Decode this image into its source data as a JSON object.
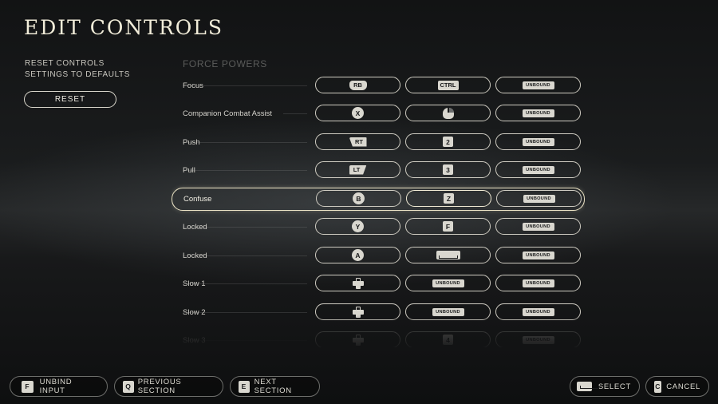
{
  "page": {
    "title": "EDIT CONTROLS"
  },
  "reset": {
    "description_line1": "RESET CONTROLS",
    "description_line2": "SETTINGS TO DEFAULTS",
    "button_label": "RESET"
  },
  "section": {
    "title": "FORCE POWERS"
  },
  "rows": [
    {
      "label": "Focus",
      "gamepad": "RB",
      "gamepad_icon": "rb-bumper-icon",
      "keyboard": "CTRL",
      "keyboard_icon": "ctrl-key-icon",
      "alt": "UNBOUND"
    },
    {
      "label": "Companion Combat Assist",
      "gamepad": "X",
      "gamepad_icon": "x-button-icon",
      "keyboard": "",
      "keyboard_icon": "mouse-right-click-icon",
      "alt": "UNBOUND"
    },
    {
      "label": "Push",
      "gamepad": "RT",
      "gamepad_icon": "rt-trigger-icon",
      "keyboard": "2",
      "keyboard_icon": "key-2-icon",
      "alt": "UNBOUND"
    },
    {
      "label": "Pull",
      "gamepad": "LT",
      "gamepad_icon": "lt-trigger-icon",
      "keyboard": "3",
      "keyboard_icon": "key-3-icon",
      "alt": "UNBOUND"
    },
    {
      "label": "Confuse",
      "gamepad": "B",
      "gamepad_icon": "b-button-icon",
      "keyboard": "Z",
      "keyboard_icon": "key-z-icon",
      "alt": "UNBOUND",
      "selected": true
    },
    {
      "label": "Locked",
      "gamepad": "Y",
      "gamepad_icon": "y-button-icon",
      "keyboard": "F",
      "keyboard_icon": "key-f-icon",
      "alt": "UNBOUND"
    },
    {
      "label": "Locked",
      "gamepad": "A",
      "gamepad_icon": "a-button-icon",
      "keyboard": "",
      "keyboard_icon": "spacebar-icon",
      "alt": "UNBOUND"
    },
    {
      "label": "Slow 1",
      "gamepad": "",
      "gamepad_icon": "dpad-up-icon",
      "keyboard": "UNBOUND",
      "keyboard_icon": "unbound-icon",
      "alt": "UNBOUND"
    },
    {
      "label": "Slow 2",
      "gamepad": "",
      "gamepad_icon": "dpad-up-icon",
      "keyboard": "UNBOUND",
      "keyboard_icon": "unbound-icon",
      "alt": "UNBOUND"
    },
    {
      "label": "Slow 3",
      "gamepad": "",
      "gamepad_icon": "dpad-up-icon",
      "keyboard": "4",
      "keyboard_icon": "key-4-icon",
      "alt": "UNBOUND"
    }
  ],
  "footer": {
    "unbind": {
      "key": "F",
      "label": "UNBIND INPUT"
    },
    "previous": {
      "key": "Q",
      "label": "PREVIOUS SECTION"
    },
    "next": {
      "key": "E",
      "label": "NEXT SECTION"
    },
    "select": {
      "key_icon": "spacebar-icon",
      "label": "SELECT"
    },
    "cancel": {
      "key": "C",
      "label": "CANCEL"
    }
  }
}
